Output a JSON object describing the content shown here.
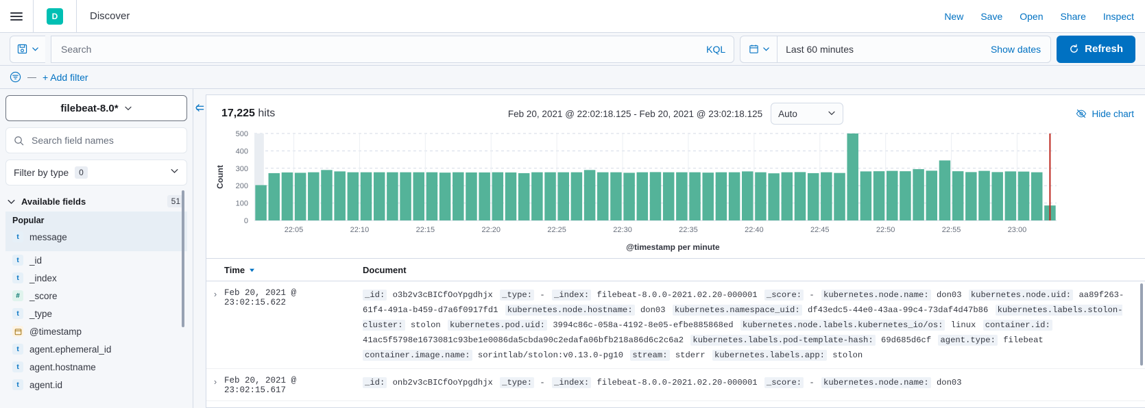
{
  "nav": {
    "app_badge": "D",
    "app_title": "Discover",
    "links": [
      {
        "label": "New",
        "name": "nav-new"
      },
      {
        "label": "Save",
        "name": "nav-save"
      },
      {
        "label": "Open",
        "name": "nav-open"
      },
      {
        "label": "Share",
        "name": "nav-share"
      },
      {
        "label": "Inspect",
        "name": "nav-inspect"
      }
    ]
  },
  "query_bar": {
    "search_value": "",
    "search_placeholder": "Search",
    "language_label": "KQL",
    "date_range_label": "Last 60 minutes",
    "show_dates_label": "Show dates",
    "refresh_label": "Refresh"
  },
  "filter_bar": {
    "dash": "—",
    "add_filter_label": "+ Add filter"
  },
  "sidebar": {
    "index_pattern": "filebeat-8.0*",
    "field_search_placeholder": "Search field names",
    "field_search_value": "",
    "filter_by_type_label": "Filter by type",
    "filter_by_type_count": "0",
    "available_fields_label": "Available fields",
    "available_fields_count": "51",
    "popular_label": "Popular",
    "popular_fields": [
      {
        "type": "t",
        "name": "message"
      }
    ],
    "fields": [
      {
        "type": "t",
        "name": "_id"
      },
      {
        "type": "t",
        "name": "_index"
      },
      {
        "type": "n",
        "name": "_score"
      },
      {
        "type": "t",
        "name": "_type"
      },
      {
        "type": "d",
        "name": "@timestamp"
      },
      {
        "type": "t",
        "name": "agent.ephemeral_id"
      },
      {
        "type": "t",
        "name": "agent.hostname"
      },
      {
        "type": "t",
        "name": "agent.id"
      }
    ]
  },
  "main": {
    "hits_count": "17,225",
    "hits_label": "hits",
    "time_range": "Feb 20, 2021 @ 22:02:18.125 - Feb 20, 2021 @ 23:02:18.125",
    "interval_label": "Auto",
    "hide_chart_label": "Hide chart"
  },
  "chart_data": {
    "type": "bar",
    "title": "",
    "xlabel": "@timestamp per minute",
    "ylabel": "Count",
    "ylim": [
      0,
      500
    ],
    "yticks": [
      0,
      100,
      200,
      300,
      400,
      500
    ],
    "grid": true,
    "legend": "none",
    "bar_color": "#54b399",
    "tick_labels": [
      "22:05",
      "22:10",
      "22:15",
      "22:20",
      "22:25",
      "22:30",
      "22:35",
      "22:40",
      "22:45",
      "22:50",
      "22:55",
      "23:00"
    ],
    "categories": [
      "22:02",
      "22:03",
      "22:04",
      "22:05",
      "22:06",
      "22:07",
      "22:08",
      "22:09",
      "22:10",
      "22:11",
      "22:12",
      "22:13",
      "22:14",
      "22:15",
      "22:16",
      "22:17",
      "22:18",
      "22:19",
      "22:20",
      "22:21",
      "22:22",
      "22:23",
      "22:24",
      "22:25",
      "22:26",
      "22:27",
      "22:28",
      "22:29",
      "22:30",
      "22:31",
      "22:32",
      "22:33",
      "22:34",
      "22:35",
      "22:36",
      "22:37",
      "22:38",
      "22:39",
      "22:40",
      "22:41",
      "22:42",
      "22:43",
      "22:44",
      "22:45",
      "22:46",
      "22:47",
      "22:48",
      "22:49",
      "22:50",
      "22:51",
      "22:52",
      "22:53",
      "22:54",
      "22:55",
      "22:56",
      "22:57",
      "22:58",
      "22:59",
      "23:00",
      "23:01",
      "23:02"
    ],
    "values": [
      203,
      272,
      276,
      274,
      277,
      290,
      282,
      277,
      277,
      277,
      277,
      277,
      277,
      277,
      275,
      277,
      276,
      276,
      277,
      276,
      272,
      277,
      277,
      277,
      277,
      290,
      277,
      277,
      274,
      277,
      278,
      277,
      277,
      277,
      275,
      277,
      277,
      282,
      277,
      271,
      277,
      278,
      272,
      277,
      273,
      500,
      282,
      283,
      285,
      283,
      295,
      286,
      345,
      283,
      278,
      285,
      278,
      282,
      281,
      277,
      86
    ]
  },
  "doc_table": {
    "columns": [
      {
        "label": "Time",
        "name": "column-time",
        "sorted": true
      },
      {
        "label": "Document",
        "name": "column-document"
      }
    ],
    "rows": [
      {
        "time": "Feb 20, 2021 @ 23:02:15.622",
        "fields": [
          {
            "key": "_id:",
            "value": "o3b2v3cBICfOoYpgdhjx"
          },
          {
            "key": "_type:",
            "value": "-"
          },
          {
            "key": "_index:",
            "value": "filebeat-8.0.0-2021.02.20-000001"
          },
          {
            "key": "_score:",
            "value": "-"
          },
          {
            "key": "kubernetes.node.name:",
            "value": "don03"
          },
          {
            "key": "kubernetes.node.uid:",
            "value": "aa89f263-61f4-491a-b459-d7a6f0917fd1"
          },
          {
            "key": "kubernetes.node.hostname:",
            "value": "don03"
          },
          {
            "key": "kubernetes.namespace_uid:",
            "value": "df43edc5-44e0-43aa-99c4-73daf4d47b86"
          },
          {
            "key": "kubernetes.labels.stolon-cluster:",
            "value": "stolon"
          },
          {
            "key": "kubernetes.pod.uid:",
            "value": "3994c86c-058a-4192-8e05-efbe885868ed"
          },
          {
            "key": "kubernetes.node.labels.kubernetes_io/os:",
            "value": "linux"
          },
          {
            "key": "container.id:",
            "value": "41ac5f5798e1673081c93be1e0086da5cbda90c2edafa06bfb218a86d6c2c6a2"
          },
          {
            "key": "kubernetes.labels.pod-template-hash:",
            "value": "69d685d6cf"
          },
          {
            "key": "agent.type:",
            "value": "filebeat"
          },
          {
            "key": "container.image.name:",
            "value": "sorintlab/stolon:v0.13.0-pg10"
          },
          {
            "key": "stream:",
            "value": "stderr"
          },
          {
            "key": "kubernetes.labels.app:",
            "value": "stolon"
          }
        ]
      },
      {
        "time": "Feb 20, 2021 @ 23:02:15.617",
        "fields": [
          {
            "key": "_id:",
            "value": "onb2v3cBICfOoYpgdhjx"
          },
          {
            "key": "_type:",
            "value": "-"
          },
          {
            "key": "_index:",
            "value": "filebeat-8.0.0-2021.02.20-000001"
          },
          {
            "key": "_score:",
            "value": "-"
          },
          {
            "key": "kubernetes.node.name:",
            "value": "don03"
          }
        ]
      }
    ]
  }
}
